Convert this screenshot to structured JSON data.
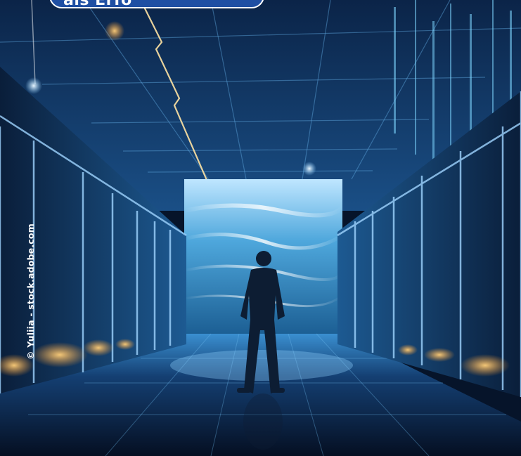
{
  "banner": {
    "text": "als Erfo"
  },
  "credit": {
    "text": "© Yuliia - stock.adobe.com"
  },
  "colors": {
    "banner_bg": "#1f4fa3",
    "accent_glow": "#4fb6ff",
    "warm_light": "#ffb24a"
  },
  "scene": {
    "subject": "person standing in data center aisle facing large digital ocean display"
  }
}
